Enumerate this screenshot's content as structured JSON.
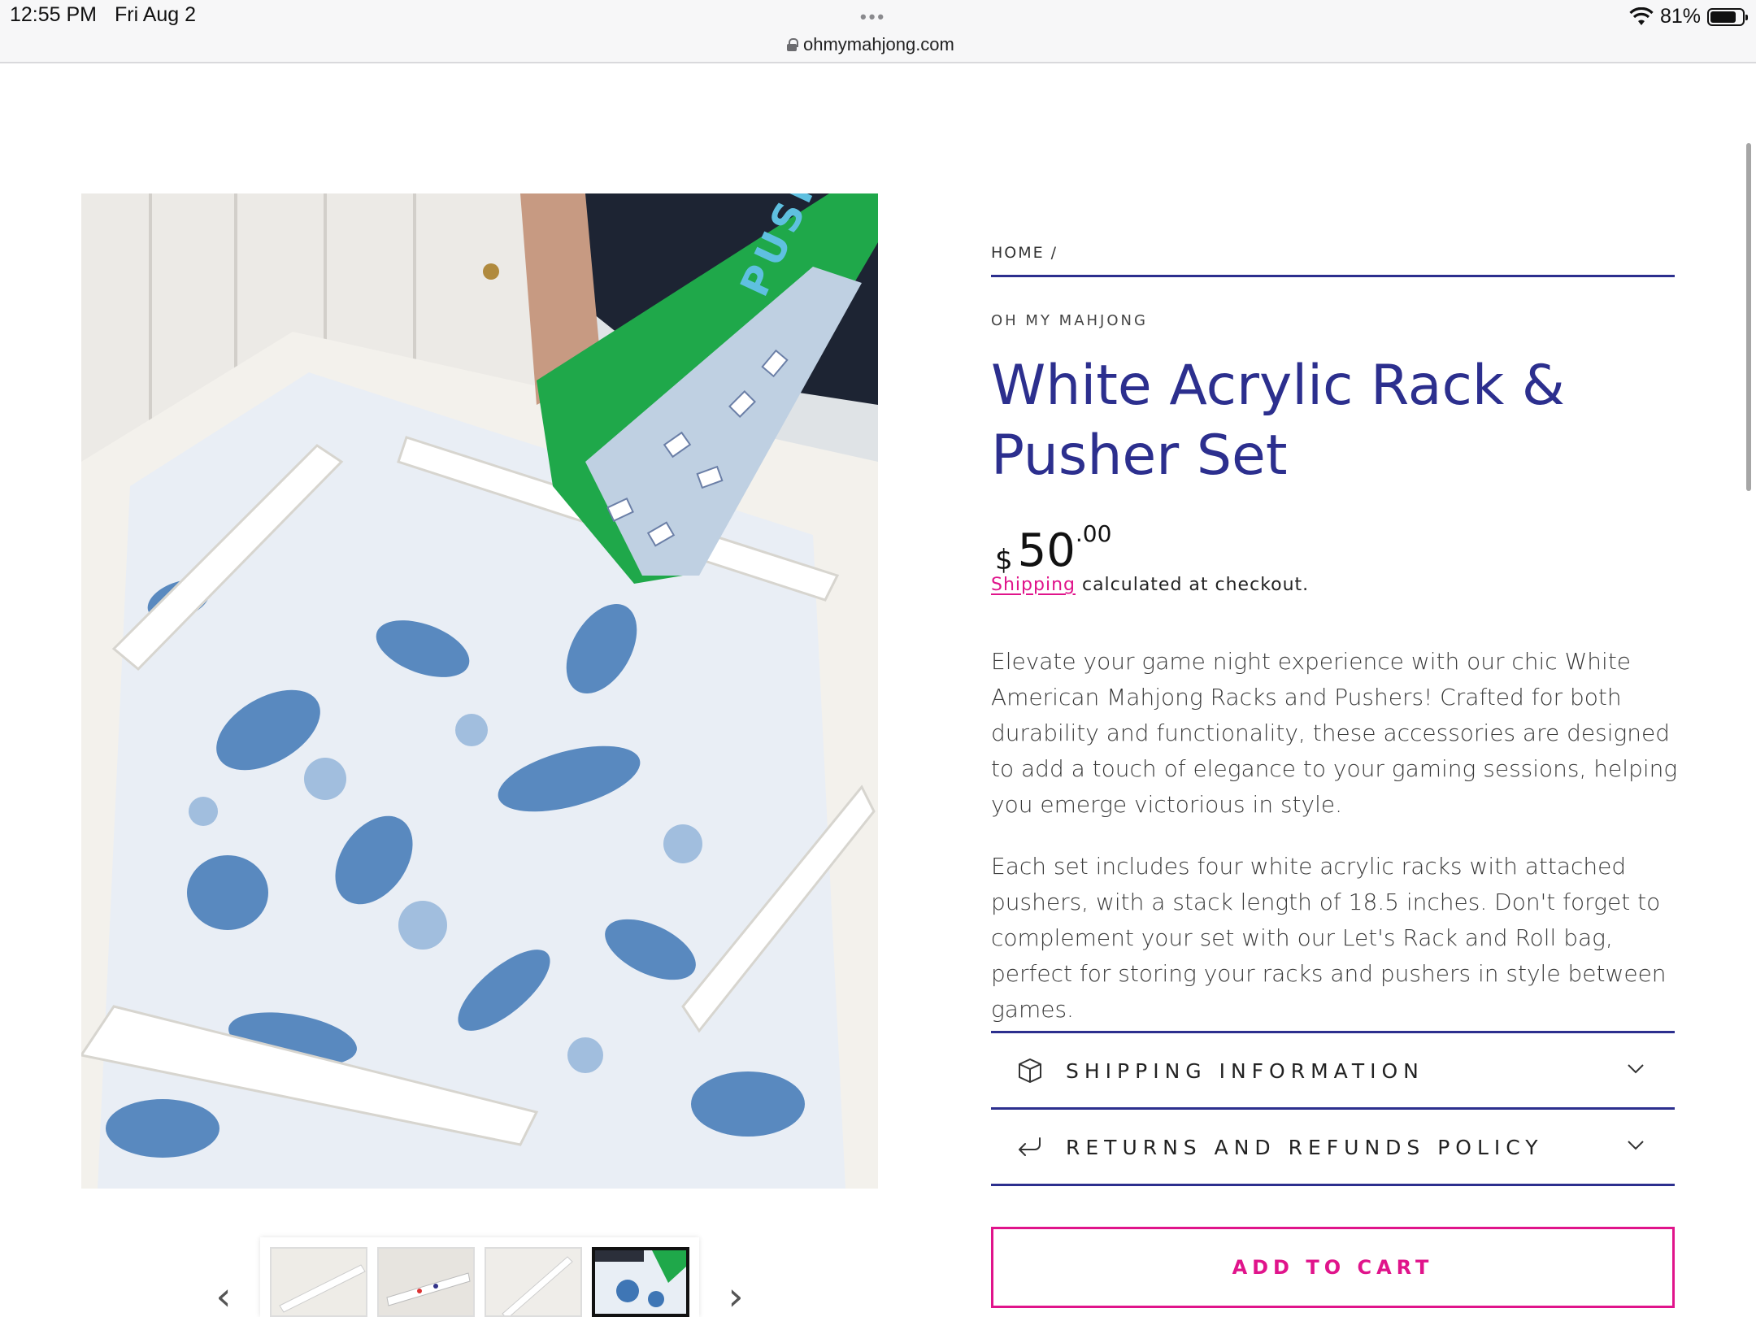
{
  "status_bar": {
    "time": "12:55 PM",
    "date": "Fri Aug 2",
    "url": "ohmymahjong.com",
    "battery": "81%",
    "battery_level": 0.81
  },
  "breadcrumb": {
    "home": "HOME /"
  },
  "product": {
    "vendor": "OH MY MAHJONG",
    "title": "White Acrylic Rack & Pusher Set",
    "price_currency": "$",
    "price_main": "50",
    "price_cents": ".00",
    "shipping_link": "Shipping",
    "shipping_rest": " calculated at checkout.",
    "description_1": "Elevate your game night experience with our chic White American Mahjong Racks and Pushers! Crafted for both durability and functionality, these accessories are designed to add a touch of elegance to your gaming sessions, helping you emerge victorious in style.",
    "description_2": "Each set includes four white acrylic racks with attached pushers, with a stack length of 18.5 inches. Don't forget to complement your set with our Let's Rack and Roll bag, perfect for storing your racks and pushers in style between games."
  },
  "image_text": {
    "bag_print": "PUSH IT"
  },
  "accordion": {
    "shipping_label": "SHIPPING INFORMATION",
    "returns_label": "RETURNS AND REFUNDS POLICY"
  },
  "cart": {
    "add_label": "ADD TO CART"
  },
  "thumbnails": {
    "count": 4,
    "active_index": 3
  },
  "colors": {
    "brand_blue": "#2c2f8e",
    "accent_pink": "#e0148b",
    "bag_green": "#1fa84a"
  }
}
